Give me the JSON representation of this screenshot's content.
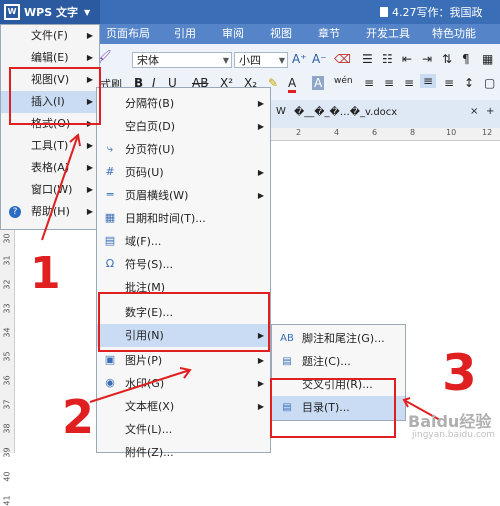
{
  "app": {
    "name": "WPS 文字",
    "doc_title": "4.27写作：我国政"
  },
  "menu_tabs": [
    "页面布局",
    "引用",
    "审阅",
    "视图",
    "章节",
    "开发工具",
    "特色功能"
  ],
  "toolbar": {
    "font_name": "宋体",
    "font_size": "小四",
    "left_label": "式刷",
    "bold": "B",
    "italic": "I",
    "underline": "U",
    "strike": "AB",
    "sup": "X²",
    "sub": "X₂",
    "clear": "A"
  },
  "doc_tab": "�__�_�…�_v.docx",
  "ruler_nums": [
    "2",
    "4",
    "6",
    "8",
    "10",
    "12"
  ],
  "left_ruler_nums": [
    "30",
    "31",
    "32",
    "33",
    "34",
    "35",
    "36",
    "37",
    "38",
    "39",
    "40",
    "41"
  ],
  "main_menu": [
    {
      "label": "文件(F)",
      "sub": true
    },
    {
      "label": "编辑(E)",
      "sub": true
    },
    {
      "label": "视图(V)",
      "sub": true
    },
    {
      "label": "插入(I)",
      "sub": true
    },
    {
      "label": "格式(O)",
      "sub": true
    },
    {
      "label": "工具(T)",
      "sub": true
    },
    {
      "label": "表格(A)",
      "sub": true
    },
    {
      "label": "窗口(W)",
      "sub": true
    },
    {
      "label": "帮助(H)",
      "sub": true
    }
  ],
  "insert_menu": [
    {
      "label": "分隔符(B)",
      "icon": "",
      "sub": true
    },
    {
      "label": "空白页(D)",
      "icon": "",
      "sub": true
    },
    {
      "label": "分页符(U)",
      "icon": "⤷",
      "sub": false
    },
    {
      "label": "页码(U)",
      "icon": "#",
      "sub": true
    },
    {
      "label": "页眉横线(W)",
      "icon": "═",
      "sub": true
    },
    {
      "label": "日期和时间(T)...",
      "icon": "▦",
      "sub": false
    },
    {
      "label": "域(F)...",
      "icon": "▤",
      "sub": false
    },
    {
      "label": "符号(S)...",
      "icon": "Ω",
      "sub": false
    },
    {
      "label": "批注(M)",
      "icon": "",
      "sub": false
    },
    {
      "label": "数字(E)...",
      "icon": "",
      "sub": false
    },
    {
      "label": "引用(N)",
      "icon": "",
      "sub": true
    },
    {
      "label": "图片(P)",
      "icon": "▣",
      "sub": true
    },
    {
      "label": "水印(G)",
      "icon": "◉",
      "sub": true
    },
    {
      "label": "文本框(X)",
      "icon": "",
      "sub": true
    },
    {
      "label": "文件(L)...",
      "icon": "",
      "sub": false
    },
    {
      "label": "附件(Z)...",
      "icon": "",
      "sub": false
    }
  ],
  "ref_menu": [
    {
      "label": "脚注和尾注(G)...",
      "icon": "AB"
    },
    {
      "label": "题注(C)...",
      "icon": "▤"
    },
    {
      "label": "交叉引用(R)...",
      "icon": ""
    },
    {
      "label": "目录(T)...",
      "icon": "▤"
    }
  ],
  "annotations": {
    "one": "1",
    "two": "2",
    "three": "3"
  },
  "watermark": {
    "main": "Baidu经验",
    "sub": "jingyan.baidu.com"
  }
}
